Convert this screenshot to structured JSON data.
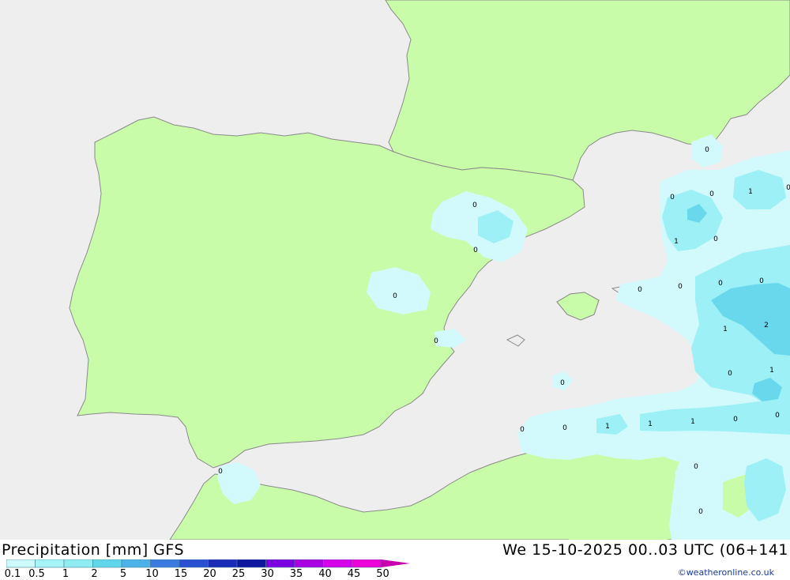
{
  "header": {
    "title": "Precipitation [mm] GFS",
    "datetime": "We 15-10-2025 00..03 UTC (06+141",
    "credit": "©weatheronline.co.uk"
  },
  "legend": {
    "ticks": [
      "0.1",
      "0.5",
      "1",
      "2",
      "5",
      "10",
      "15",
      "20",
      "25",
      "30",
      "35",
      "40",
      "45",
      "50"
    ],
    "colors": [
      "#ccfaff",
      "#a6f3f8",
      "#8eecf2",
      "#5fd6ea",
      "#4cb2e8",
      "#3b7be0",
      "#2a50d2",
      "#1a2bb8",
      "#0f16a0",
      "#7a00e0",
      "#a800e0",
      "#d400e8",
      "#ee00d8",
      "#c800b0"
    ]
  },
  "map": {
    "colors": {
      "land": "#c8fca8",
      "sea": "#eeeeee",
      "coast": "#8a8a8a",
      "precip_light": "#d2fafc",
      "precip_mid": "#9cf0f6",
      "precip_heavy": "#6ad8ec"
    },
    "contour_labels": [
      "0",
      "0",
      "0",
      "0",
      "0",
      "0",
      "0",
      "0",
      "0",
      "0",
      "1",
      "0",
      "0",
      "0",
      "0",
      "0",
      "2",
      "1",
      "0",
      "1",
      "0",
      "0",
      "0",
      "0",
      "1",
      "1",
      "1",
      "0",
      "0",
      "0",
      "0",
      "1"
    ]
  }
}
